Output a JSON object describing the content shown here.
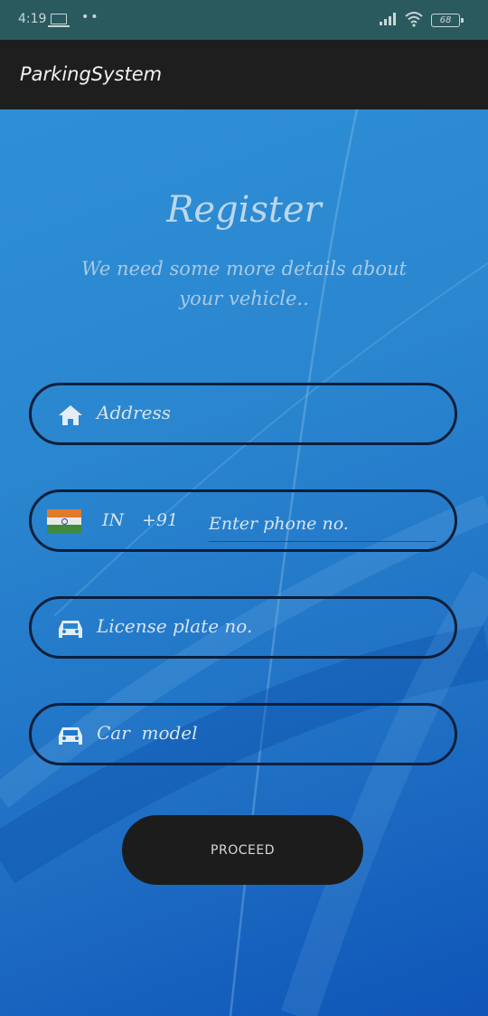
{
  "status_bar": {
    "time": "4:19",
    "battery": "68"
  },
  "app_bar": {
    "title": "ParkingSystem"
  },
  "form": {
    "heading": "Register",
    "subheading": "We need some more details about your vehicle..",
    "address": {
      "placeholder": "Address",
      "icon": "home-icon"
    },
    "phone": {
      "country_code": "IN",
      "dial_code": "+91",
      "placeholder": "Enter phone no.",
      "icon": "india-flag-icon"
    },
    "license_plate": {
      "placeholder": "License plate no.",
      "icon": "car-icon"
    },
    "car_model": {
      "placeholder": "Car  model",
      "icon": "car-icon"
    },
    "proceed_label": "PROCEED"
  },
  "colors": {
    "background": "#2a86cf",
    "app_bar": "#1e1e1e",
    "button": "#1c1c1c",
    "field_border": "#0e1f3a"
  }
}
